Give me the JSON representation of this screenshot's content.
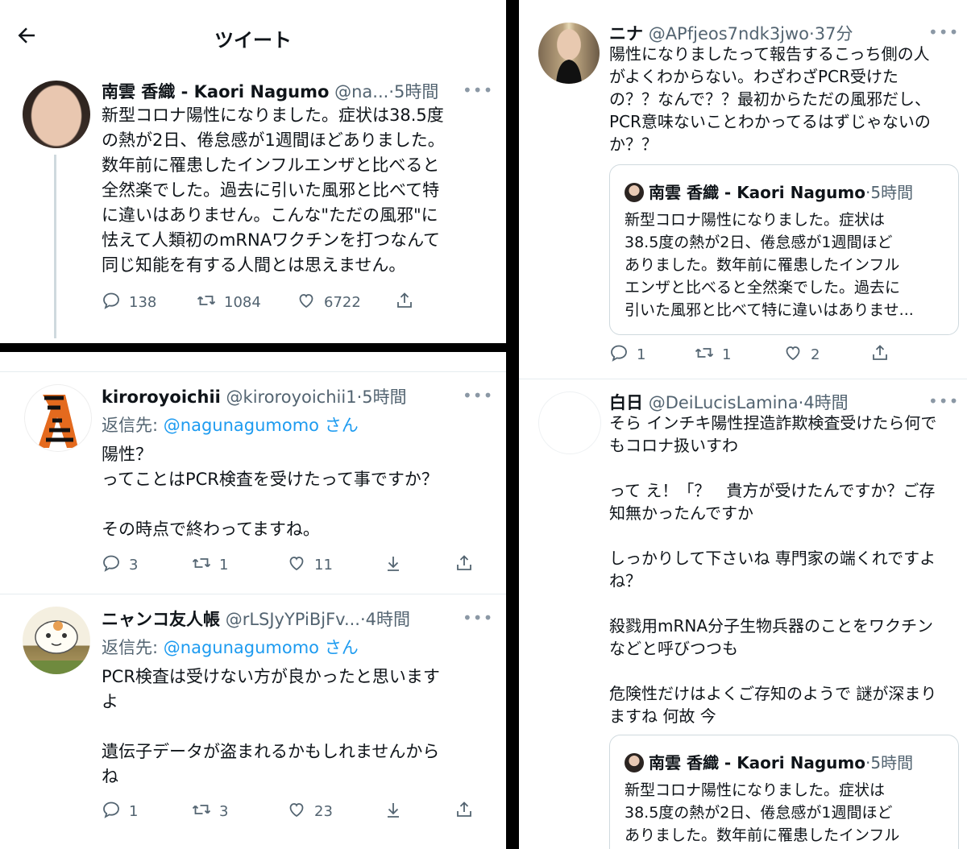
{
  "header": {
    "title": "ツイート"
  },
  "main_tweet": {
    "name": "南雲 香織 - Kaori Nagumo",
    "handle": "@na...",
    "time": "5時間",
    "text": "新型コロナ陽性になりました。症状は38.5度\nの熱が2日、倦怠感が1週間ほどありました。\n数年前に罹患したインフルエンザと比べると\n全然楽でした。過去に引いた風邪と比べて特\nに違いはありません。こんな\"ただの風邪\"に\n怯えて人類初のmRNAワクチンを打つなんて\n同じ知能を有する人間とは思えません。",
    "replies": "138",
    "retweets": "1084",
    "likes": "6722"
  },
  "replies": [
    {
      "name": "kiroroyoichii",
      "handle": "@kiroroyoichii1",
      "time": "5時間",
      "reply_prefix": "返信先:",
      "reply_to": "@nagunagumomo",
      "reply_suffix": "さん",
      "text": "陽性？\nってことはPCR検査を受けたって事ですか？\n\nその時点で終わってますね。",
      "replies": "3",
      "retweets": "1",
      "likes": "11"
    },
    {
      "name": "ニャンコ友人帳",
      "handle": "@rLSJyYPiBjFv...",
      "time": "4時間",
      "reply_prefix": "返信先:",
      "reply_to": "@nagunagumomo",
      "reply_suffix": "さん",
      "text": "PCR検査は受けない方が良かったと思います\nよ\n\n遺伝子データが盗まれるかもしれませんから\nね",
      "replies": "1",
      "retweets": "3",
      "likes": "23"
    }
  ],
  "right_tweets": [
    {
      "name": "ニナ",
      "handle": "@APfjeos7ndk3jwo",
      "time": "37分",
      "text": "陽性になりましたって報告するこっち側の人\nがよくわからない。わざわざPCR受けた\nの？？なんで？？最初からただの風邪だし、\nPCR意味ないことわかってるはずじゃないの\nか？？",
      "quote": {
        "name": "南雲 香織 - Kaori Nagumo",
        "time": "5時間",
        "text": "新型コロナ陽性になりました。症状は\n38.5度の熱が2日、倦怠感が1週間ほど\nありました。数年前に罹患したインフル\nエンザと比べると全然楽でした。過去に\n引いた風邪と比べて特に違いはありませ..."
      },
      "replies": "1",
      "retweets": "1",
      "likes": "2"
    },
    {
      "name": "白日",
      "handle": "@DeiLucisLamina",
      "time": "4時間",
      "text": "そら インチキ陽性捏造詐欺検査受けたら何で\nもコロナ扱いすわ\n\nって え！「？　貴方が受けたんですか？ご存\n知無かったんですか\n\nしっかりして下さいね 専門家の端くれですよ\nね？\n\n殺戮用mRNA分子生物兵器のことをワクチン\nなどと呼びつつも\n\n危険性だけはよくご存知のようで 謎が深まり\nますね 何故 今",
      "quote": {
        "name": "南雲 香織 - Kaori Nagumo",
        "time": "5時間",
        "text": "新型コロナ陽性になりました。症状は\n38.5度の熱が2日、倦怠感が1週間ほど\nありました。数年前に罹患したインフル"
      }
    }
  ],
  "icons": {
    "back": "back-arrow-icon",
    "more": "more-dots-icon",
    "reply": "reply-bubble-icon",
    "retweet": "retweet-icon",
    "like": "heart-icon",
    "share": "share-icon",
    "download": "download-icon"
  },
  "colors": {
    "link": "#1d9bf0",
    "muted": "#536471",
    "divider": "#000000"
  }
}
